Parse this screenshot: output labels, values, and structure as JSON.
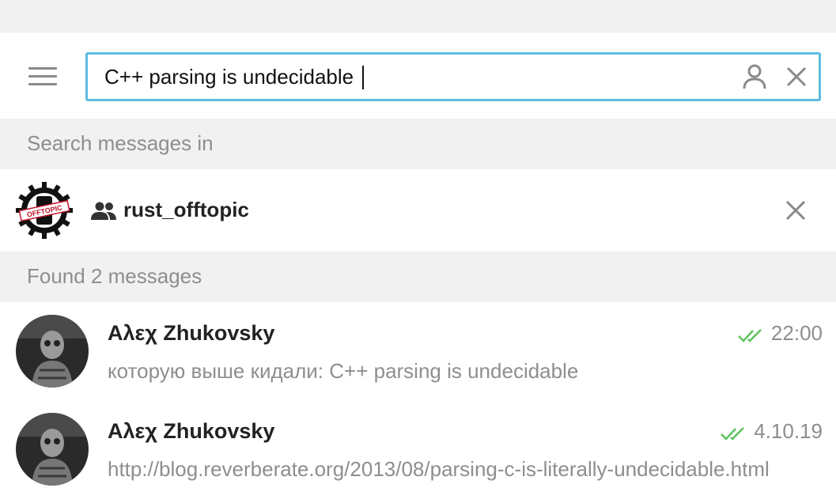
{
  "search": {
    "query": "C++ parsing is undecidable"
  },
  "sections": {
    "search_in": "Search messages in",
    "found": "Found 2 messages"
  },
  "chat": {
    "name": "rust_offtopic",
    "avatar_label": "OFFTOPIC"
  },
  "messages": [
    {
      "sender": "Αλεχ Zhukovsky",
      "time": "22:00",
      "text": "которую выше кидали: C++ parsing is undecidable",
      "read": true
    },
    {
      "sender": "Αλεχ Zhukovsky",
      "time": "4.10.19",
      "text": "http://blog.reverberate.org/2013/08/parsing-c-is-literally-undecidable.html",
      "read": true
    }
  ],
  "colors": {
    "accent": "#5dbbe2",
    "read_check": "#5cc35c",
    "section_bg": "#f1f1f1",
    "muted_text": "#8e8e8e"
  },
  "icons": {
    "menu": "hamburger-menu-icon",
    "person": "person-icon",
    "clear": "close-icon",
    "group": "group-icon",
    "check": "double-check-icon"
  }
}
